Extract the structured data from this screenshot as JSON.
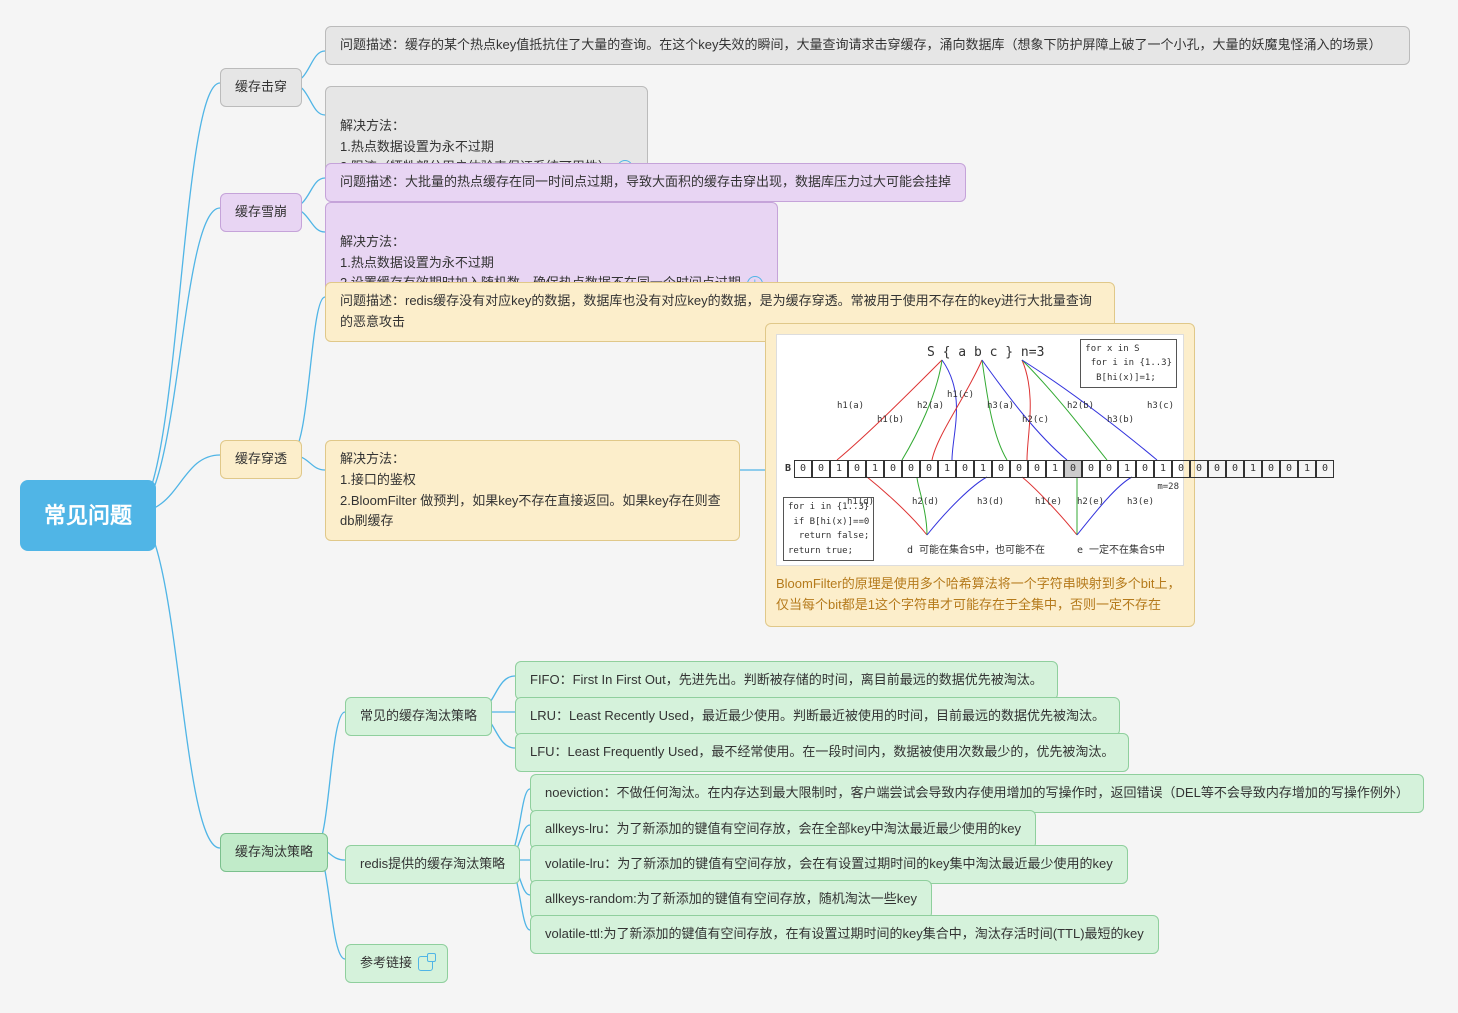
{
  "root": "常见问题",
  "branches": {
    "breakdown": {
      "title": "缓存击穿",
      "desc": "问题描述：缓存的某个热点key值抵抗住了大量的查询。在这个key失效的瞬间，大量查询请求击穿缓存，涌向数据库（想象下防护屏障上破了一个小孔，大量的妖魔鬼怪涌入的场景）",
      "solve": "解决方法：\n1.热点数据设置为永不过期\n2.限流（牺牲部分用户体验来保证系统可用性）"
    },
    "avalanche": {
      "title": "缓存雪崩",
      "desc": "问题描述：大批量的热点缓存在同一时间点过期，导致大面积的缓存击穿出现，数据库压力过大可能会挂掉",
      "solve": "解决方法：\n1.热点数据设置为永不过期\n2.设置缓存有效期时加入随机数，确保热点数据不在同一个时间点过期"
    },
    "penetrate": {
      "title": "缓存穿透",
      "desc": "问题描述：redis缓存没有对应key的数据，数据库也没有对应key的数据，是为缓存穿透。常被用于使用不存在的key进行大批量查询的恶意攻击",
      "solve": "解决方法：\n1.接口的鉴权\n2.BloomFilter 做预判，如果key不存在直接返回。如果key存在则查db刷缓存",
      "bloom_caption": "BloomFilter的原理是使用多个哈希算法将一个字符串映射到多个bit上，仅当每个bit都是1这个字符串才可能存在于全集中，否则一定不存在",
      "bloom_set": "S { a  b  c } n=3",
      "bloom_code1": "for x in S\n for i in {1..3}\n  B[hi(x)]=1;",
      "bloom_code2": "for i in {1..3}\n if B[hi(x)]==0\n  return false;\nreturn true;",
      "bloom_d": "d  可能在集合S中，也可能不在",
      "bloom_e": "e  一定不在集合S中",
      "bloom_m": "m=28"
    },
    "eviction": {
      "title": "缓存淘汰策略",
      "common": {
        "title": "常见的缓存淘汰策略",
        "fifo": "FIFO：First In First Out，先进先出。判断被存储的时间，离目前最远的数据优先被淘汰。",
        "lru": "LRU：Least Recently Used，最近最少使用。判断最近被使用的时间，目前最远的数据优先被淘汰。",
        "lfu": "LFU：Least Frequently Used，最不经常使用。在一段时间内，数据被使用次数最少的，优先被淘汰。"
      },
      "redis": {
        "title": "redis提供的缓存淘汰策略",
        "noeviction": "noeviction：不做任何淘汰。在内存达到最大限制时，客户端尝试会导致内存使用增加的写操作时，返回错误（DEL等不会导致内存增加的写操作例外）",
        "allkeys_lru": "allkeys-lru：为了新添加的键值有空间存放，会在全部key中淘汰最近最少使用的key",
        "volatile_lru": "volatile-lru：为了新添加的键值有空间存放，会在有设置过期时间的key集中淘汰最近最少使用的key",
        "allkeys_random": "allkeys-random:为了新添加的键值有空间存放，随机淘汰一些key",
        "volatile_ttl": "volatile-ttl:为了新添加的键值有空间存放，在有设置过期时间的key集合中，淘汰存活时间(TTL)最短的key"
      },
      "reference": "参考链接"
    }
  }
}
